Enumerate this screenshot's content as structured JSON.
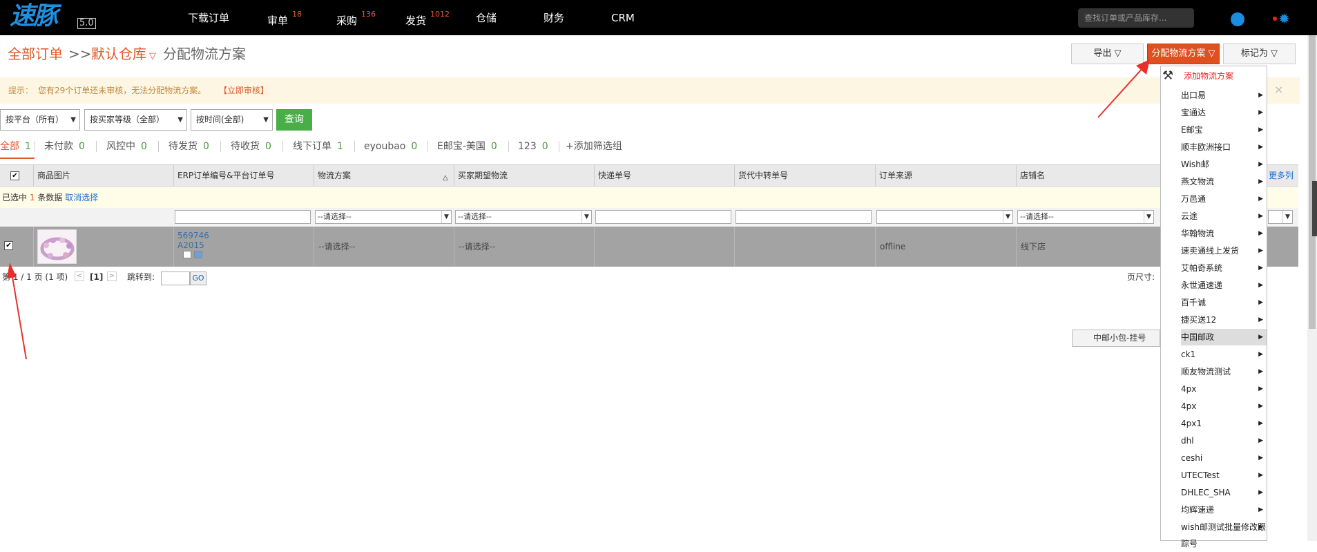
{
  "app": {
    "logo": "速豚",
    "version": "5.0"
  },
  "nav": {
    "items": [
      {
        "label": "下载订单",
        "badge": ""
      },
      {
        "label": "审单",
        "badge": "18"
      },
      {
        "label": "采购",
        "badge": "136"
      },
      {
        "label": "发货",
        "badge": "1012"
      },
      {
        "label": "仓储",
        "badge": ""
      },
      {
        "label": "财务",
        "badge": ""
      },
      {
        "label": "CRM",
        "badge": ""
      }
    ],
    "search_placeholder": "查找订单或产品库存..."
  },
  "breadcrumb": {
    "all_orders": "全部订单",
    "sep": ">>",
    "warehouse": "默认仓库",
    "warehouse_caret": "▽",
    "current": "分配物流方案"
  },
  "actions": {
    "export": "导出 ▽",
    "assign": "分配物流方案 ▽",
    "mark_as": "标记为 ▽"
  },
  "tip": {
    "prefix": "提示：",
    "text": "您有29个订单还未审核，无法分配物流方案。",
    "link": "【立即审核】",
    "close": "×"
  },
  "filters": {
    "platform": "按平台（所有）",
    "buyer_level": "按买家等级（全部）",
    "time": "按时间(全部)",
    "query_button": "查询"
  },
  "tabs": [
    {
      "label": "全部",
      "count": "1"
    },
    {
      "label": "未付款",
      "count": "0"
    },
    {
      "label": "风控中",
      "count": "0"
    },
    {
      "label": "待发货",
      "count": "0"
    },
    {
      "label": "待收货",
      "count": "0"
    },
    {
      "label": "线下订单",
      "count": "1"
    },
    {
      "label": "eyoubao",
      "count": "0"
    },
    {
      "label": "E邮宝-美国",
      "count": "0"
    },
    {
      "label": "123",
      "count": "0"
    }
  ],
  "add_filter_group": "+添加筛选组",
  "table": {
    "headers": [
      "商品图片",
      "ERP订单编号&平台订单号",
      "物流方案",
      "买家期望物流",
      "快递单号",
      "货代中转单号",
      "订单来源",
      "店铺名"
    ],
    "sort_mark": "△",
    "more_columns": "更多列",
    "selection": {
      "prefix": "已选中",
      "count": "1",
      "suffix": "条数据",
      "cancel": "取消选择"
    },
    "filter_placeholder_select": "--请选择--",
    "rows": [
      {
        "checked": "✔",
        "erp_no": "569746",
        "platform_no": "A2015",
        "logistics": "--请选择--",
        "buyer_logistics": "--请选择--",
        "express_no": "",
        "forwarder_no": "",
        "source": "offline",
        "shop": "线下店"
      }
    ]
  },
  "pager": {
    "info": "第 1 / 1 页 (1 项)",
    "prev": "<",
    "current": "[1]",
    "next": ">",
    "jump_label": "跳转到:",
    "go": "GO",
    "page_size_label": "页尺寸:"
  },
  "dropdown": {
    "add": "添加物流方案",
    "items": [
      "出口易",
      "宝通达",
      "E邮宝",
      "顺丰欧洲接口",
      "Wish邮",
      "燕文物流",
      "万邑通",
      "云途",
      "华翰物流",
      "速卖通线上发货",
      "艾帕奇系统",
      "永世通速递",
      "百千诚",
      "捷买送12",
      "中国邮政",
      "ck1",
      "顺友物流测试",
      "4px",
      "4px",
      "4px1",
      "dhl",
      "ceshi",
      "UTECTest",
      "DHLEC_SHA",
      "均辉速递",
      "wish邮测试批量修改跟踪号"
    ],
    "highlighted_index": 14,
    "submenu_item": "中邮小包-挂号"
  },
  "colors": {
    "accent": "#e3572b",
    "brand": "#1f8fe0",
    "query": "#4aae48",
    "annotation_arrow": "#e8302a"
  }
}
